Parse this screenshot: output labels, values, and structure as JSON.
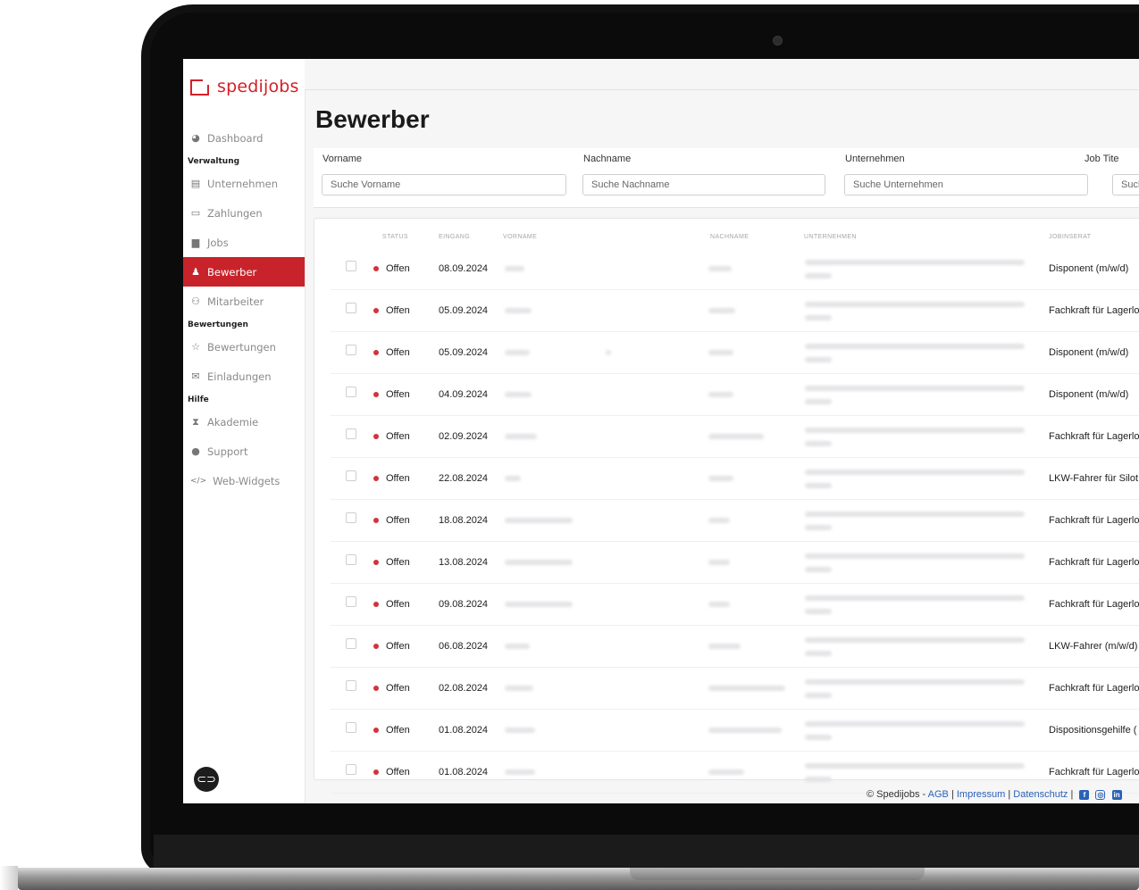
{
  "brand": {
    "name": "spedijobs",
    "color": "#d42027"
  },
  "sidebar": {
    "items": [
      {
        "type": "item",
        "label": "Dashboard",
        "icon": "dashboard-icon",
        "active": false
      },
      {
        "type": "section",
        "label": "Verwaltung"
      },
      {
        "type": "item",
        "label": "Unternehmen",
        "icon": "building-icon",
        "active": false
      },
      {
        "type": "item",
        "label": "Zahlungen",
        "icon": "credit-card-icon",
        "active": false
      },
      {
        "type": "item",
        "label": "Jobs",
        "icon": "briefcase-icon",
        "active": false
      },
      {
        "type": "item",
        "label": "Bewerber",
        "icon": "user-add-icon",
        "active": true
      },
      {
        "type": "item",
        "label": "Mitarbeiter",
        "icon": "users-icon",
        "active": false
      },
      {
        "type": "section",
        "label": "Bewertungen"
      },
      {
        "type": "item",
        "label": "Bewertungen",
        "icon": "star-icon",
        "active": false
      },
      {
        "type": "item",
        "label": "Einladungen",
        "icon": "mail-icon",
        "active": false
      },
      {
        "type": "section",
        "label": "Hilfe"
      },
      {
        "type": "item",
        "label": "Akademie",
        "icon": "hourglass-icon",
        "active": false
      },
      {
        "type": "item",
        "label": "Support",
        "icon": "help-icon",
        "active": false
      },
      {
        "type": "item",
        "label": "Web-Widgets",
        "icon": "code-icon",
        "active": false
      }
    ]
  },
  "page": {
    "title": "Bewerber"
  },
  "filters": {
    "vorname": {
      "label": "Vorname",
      "placeholder": "Suche Vorname"
    },
    "nachname": {
      "label": "Nachname",
      "placeholder": "Suche Nachname"
    },
    "unternehmen": {
      "label": "Unternehmen",
      "placeholder": "Suche Unternehmen"
    },
    "job": {
      "label": "Job Tite",
      "placeholder": "Such"
    }
  },
  "table": {
    "headers": {
      "status": "STATUS",
      "eingang": "EINGANG",
      "vorname": "VORNAME",
      "nachname": "NACHNAME",
      "unternehmen": "UNTERNEHMEN",
      "jobinserat": "JOBINSERAT"
    },
    "rows": [
      {
        "status": "Offen",
        "date": "08.09.2024",
        "job": "Disponent (m/w/d)"
      },
      {
        "status": "Offen",
        "date": "05.09.2024",
        "job": "Fachkraft für Lagerlo"
      },
      {
        "status": "Offen",
        "date": "05.09.2024",
        "job": "Disponent (m/w/d)"
      },
      {
        "status": "Offen",
        "date": "04.09.2024",
        "job": "Disponent (m/w/d)"
      },
      {
        "status": "Offen",
        "date": "02.09.2024",
        "job": "Fachkraft für Lagerlo"
      },
      {
        "status": "Offen",
        "date": "22.08.2024",
        "job": "LKW-Fahrer für Silot"
      },
      {
        "status": "Offen",
        "date": "18.08.2024",
        "job": "Fachkraft für Lagerlo"
      },
      {
        "status": "Offen",
        "date": "13.08.2024",
        "job": "Fachkraft für Lagerlo"
      },
      {
        "status": "Offen",
        "date": "09.08.2024",
        "job": "Fachkraft für Lagerlo"
      },
      {
        "status": "Offen",
        "date": "06.08.2024",
        "job": "LKW-Fahrer (m/w/d)"
      },
      {
        "status": "Offen",
        "date": "02.08.2024",
        "job": "Fachkraft für Lagerlo"
      },
      {
        "status": "Offen",
        "date": "01.08.2024",
        "job": "Dispositionsgehilfe ("
      },
      {
        "status": "Offen",
        "date": "01.08.2024",
        "job": "Fachkraft für Lagerlo"
      }
    ]
  },
  "footer": {
    "copyright": "© Spedijobs -",
    "agb": "AGB",
    "sep1": "|",
    "impressum": "Impressum",
    "sep2": "|",
    "datenschutz": "Datenschutz",
    "sep3": "|"
  },
  "colors": {
    "status_dot": "#d0343c",
    "active_nav": "#c8232a",
    "link": "#2a62b8"
  }
}
